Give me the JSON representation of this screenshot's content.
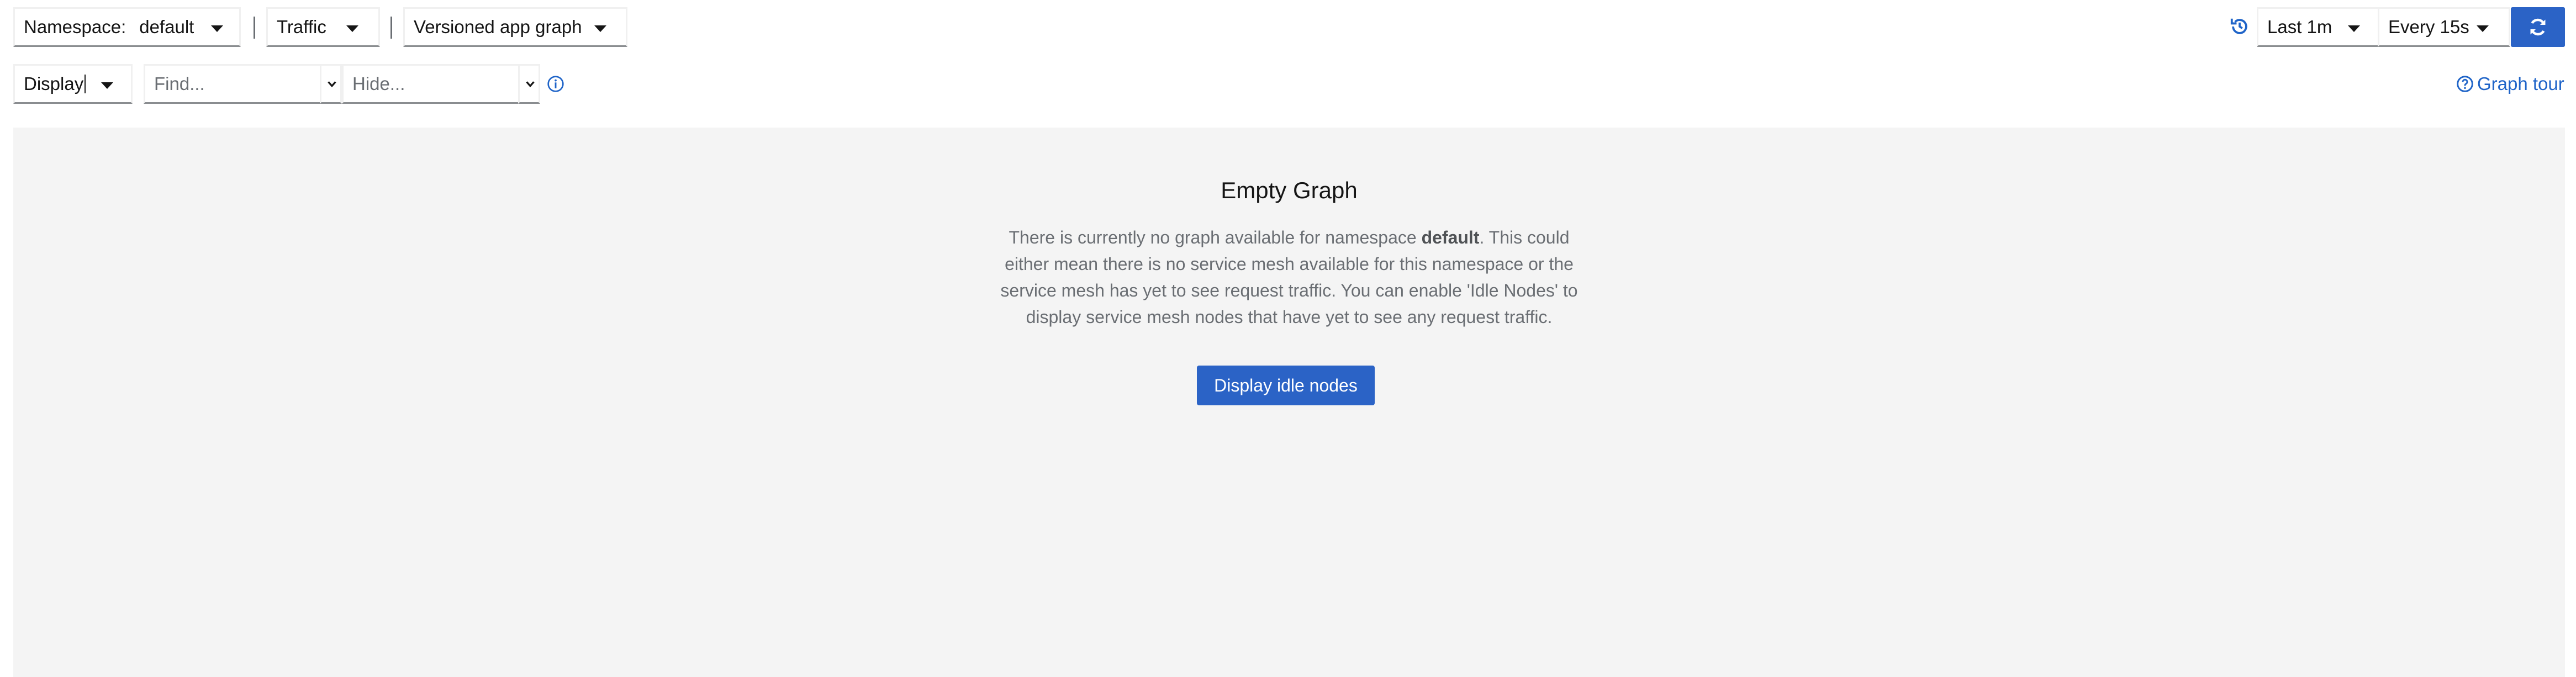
{
  "toolbar": {
    "namespace": {
      "label": "Namespace:",
      "value": "default"
    },
    "traffic": {
      "label": "Traffic"
    },
    "graph_type": {
      "value": "Versioned app graph"
    },
    "time_range": {
      "value": "Last 1m"
    },
    "refresh_interval": {
      "value": "Every 15s"
    }
  },
  "filters": {
    "display": {
      "label": "Display"
    },
    "find": {
      "placeholder": "Find..."
    },
    "hide": {
      "placeholder": "Hide..."
    },
    "graph_tour": {
      "label": "Graph tour"
    }
  },
  "empty_state": {
    "title": "Empty Graph",
    "body_before": "There is currently no graph available for namespace",
    "namespace": "default",
    "body_after": ". This could either mean there is no service mesh available for this namespace or the service mesh has yet to see request traffic. You can enable 'Idle Nodes' to display service mesh nodes that have yet to see any request traffic.",
    "button_label": "Display idle nodes"
  },
  "colors": {
    "primary": "#2b63c6",
    "link": "#1f64c8",
    "graph_background": "#f4f4f4"
  },
  "icons": [
    "chevron-down-icon",
    "history-icon",
    "sync-icon",
    "info-circle-icon",
    "question-circle-icon"
  ]
}
